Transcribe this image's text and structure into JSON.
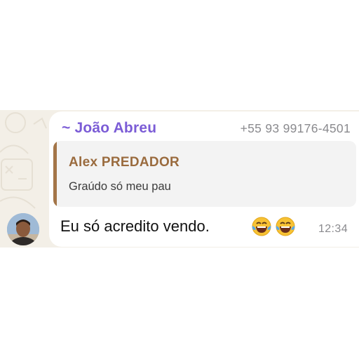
{
  "message": {
    "sender_name": "~ João Abreu",
    "sender_phone": "+55 93 99176-4501",
    "quoted": {
      "author": "Alex PREDADOR",
      "text": "Graúdo só meu pau"
    },
    "text": "Eu só acredito vendo.",
    "emojis": [
      "laughing-tears-emoji",
      "laughing-tears-emoji"
    ],
    "time": "12:34"
  },
  "colors": {
    "chat_background": "#f3efe7",
    "bubble": "#ffffff",
    "sender_name": "#7b5cd6",
    "quote_author": "#9a6b3e",
    "quote_bar": "#a37548",
    "meta_text": "#8a8a8e"
  },
  "icons": {
    "avatar": "contact-avatar"
  }
}
